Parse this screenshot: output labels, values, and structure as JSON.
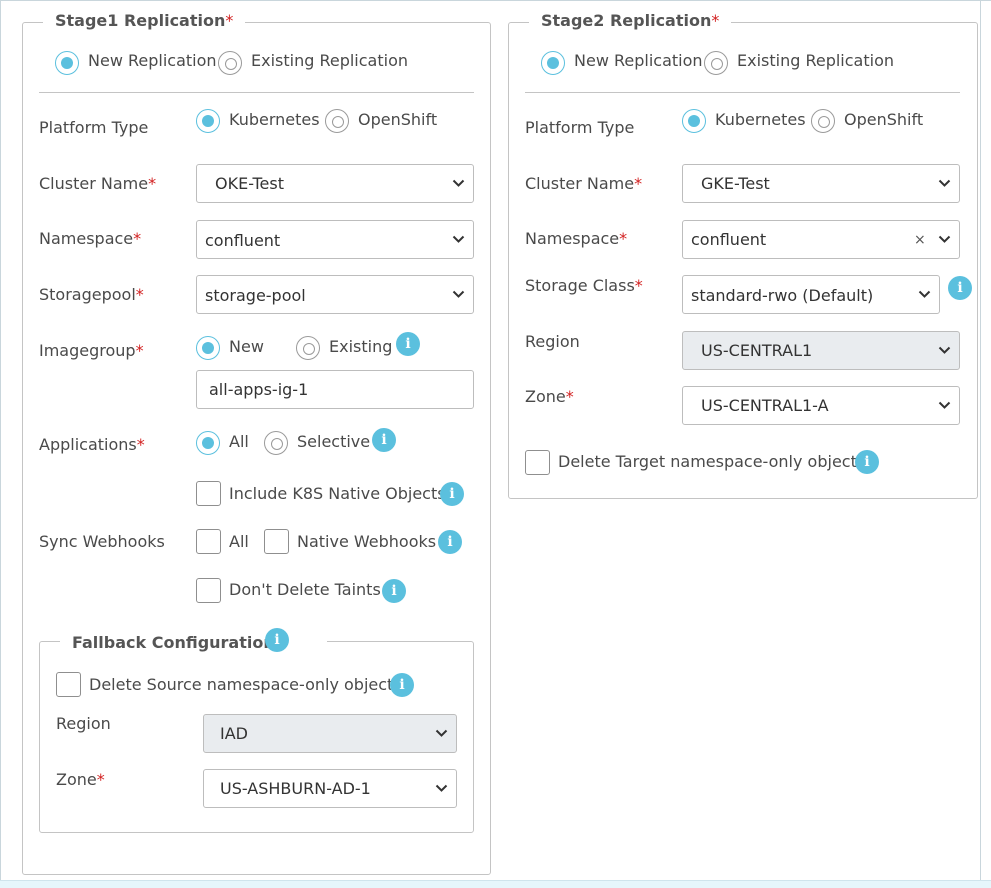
{
  "stage1": {
    "title": "Stage1 Replication",
    "required": "*",
    "replication_options": [
      "New Replication",
      "Existing Replication"
    ],
    "platform": {
      "label": "Platform Type",
      "options": [
        "Kubernetes",
        "OpenShift"
      ],
      "selected": "Kubernetes"
    },
    "cluster": {
      "label": "Cluster Name",
      "value": "OKE-Test"
    },
    "namespace": {
      "label": "Namespace",
      "value": "confluent"
    },
    "storagepool": {
      "label": "Storagepool",
      "value": "storage-pool"
    },
    "imagegroup": {
      "label": "Imagegroup",
      "options": [
        "New",
        "Existing"
      ],
      "selected": "New",
      "value": "all-apps-ig-1"
    },
    "applications": {
      "label": "Applications",
      "options": [
        "All",
        "Selective"
      ],
      "selected": "All",
      "include_native": "Include K8S Native Objects"
    },
    "sync_webhooks": {
      "label": "Sync Webhooks",
      "all": "All",
      "native": "Native Webhooks"
    },
    "dont_delete_taints": "Don't Delete Taints",
    "fallback": {
      "title": "Fallback Configuration",
      "delete_source": "Delete Source namespace-only objects",
      "region": {
        "label": "Region",
        "value": "IAD"
      },
      "zone": {
        "label": "Zone",
        "value": "US-ASHBURN-AD-1"
      }
    }
  },
  "stage2": {
    "title": "Stage2 Replication",
    "required": "*",
    "replication_options": [
      "New Replication",
      "Existing Replication"
    ],
    "platform": {
      "label": "Platform Type",
      "options": [
        "Kubernetes",
        "OpenShift"
      ],
      "selected": "Kubernetes"
    },
    "cluster": {
      "label": "Cluster Name",
      "value": "GKE-Test"
    },
    "namespace": {
      "label": "Namespace",
      "value": "confluent",
      "clear_glyph": "×"
    },
    "storage_class": {
      "label": "Storage Class",
      "value": "standard-rwo (Default)"
    },
    "region": {
      "label": "Region",
      "value": "US-CENTRAL1"
    },
    "zone": {
      "label": "Zone",
      "value": "US-CENTRAL1-A"
    },
    "delete_target": "Delete Target namespace-only objects"
  },
  "info_glyph": "i",
  "colors": {
    "accent": "#5bc0de",
    "required": "#d21f1f",
    "border": "#c4c4c4",
    "disabled_bg": "#e9ecef"
  }
}
